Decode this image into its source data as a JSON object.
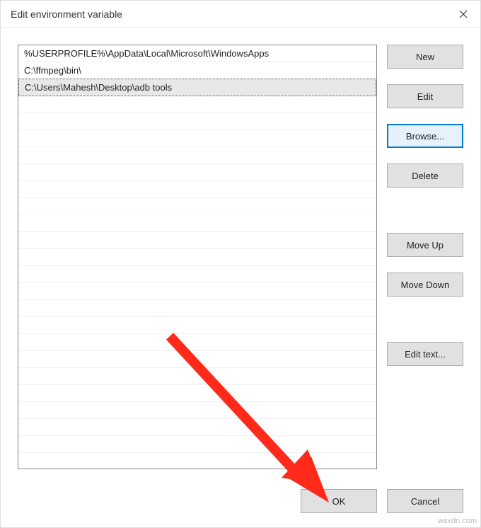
{
  "window": {
    "title": "Edit environment variable",
    "close_label": "Close"
  },
  "list": {
    "items": [
      {
        "path": "%USERPROFILE%\\AppData\\Local\\Microsoft\\WindowsApps",
        "selected": false
      },
      {
        "path": "C:\\ffmpeg\\bin\\",
        "selected": false
      },
      {
        "path": "C:\\Users\\Mahesh\\Desktop\\adb tools",
        "selected": true
      }
    ]
  },
  "buttons": {
    "new": "New",
    "edit": "Edit",
    "browse": "Browse...",
    "delete": "Delete",
    "move_up": "Move Up",
    "move_down": "Move Down",
    "edit_text": "Edit text...",
    "ok": "OK",
    "cancel": "Cancel"
  },
  "watermark": "wsxdn.com"
}
